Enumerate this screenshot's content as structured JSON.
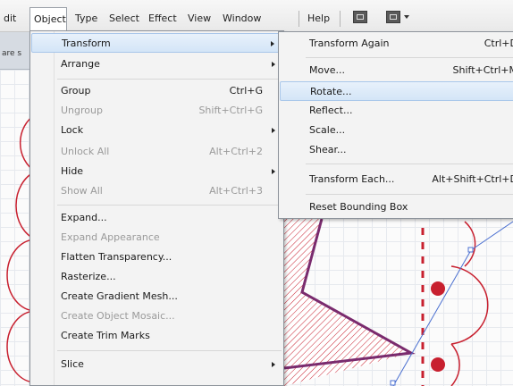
{
  "menubar": {
    "items": [
      {
        "label": "dit"
      },
      {
        "label": "Object"
      },
      {
        "label": "Type"
      },
      {
        "label": "Select"
      },
      {
        "label": "Effect"
      },
      {
        "label": "View"
      },
      {
        "label": "Window"
      },
      {
        "label": "Help"
      }
    ]
  },
  "document_tab": {
    "label": "are s"
  },
  "object_menu": {
    "items": [
      {
        "label": "Transform",
        "shortcut": ""
      },
      {
        "label": "Arrange",
        "shortcut": ""
      },
      {
        "label": "Group",
        "shortcut": "Ctrl+G"
      },
      {
        "label": "Ungroup",
        "shortcut": "Shift+Ctrl+G"
      },
      {
        "label": "Lock",
        "shortcut": ""
      },
      {
        "label": "Unlock All",
        "shortcut": "Alt+Ctrl+2"
      },
      {
        "label": "Hide",
        "shortcut": ""
      },
      {
        "label": "Show All",
        "shortcut": "Alt+Ctrl+3"
      },
      {
        "label": "Expand...",
        "shortcut": ""
      },
      {
        "label": "Expand Appearance",
        "shortcut": ""
      },
      {
        "label": "Flatten Transparency...",
        "shortcut": ""
      },
      {
        "label": "Rasterize...",
        "shortcut": ""
      },
      {
        "label": "Create Gradient Mesh...",
        "shortcut": ""
      },
      {
        "label": "Create Object Mosaic...",
        "shortcut": ""
      },
      {
        "label": "Create Trim Marks",
        "shortcut": ""
      },
      {
        "label": "Slice",
        "shortcut": ""
      }
    ]
  },
  "transform_menu": {
    "items": [
      {
        "label": "Transform Again",
        "shortcut": "Ctrl+D"
      },
      {
        "label": "Move...",
        "shortcut": "Shift+Ctrl+M"
      },
      {
        "label": "Rotate...",
        "shortcut": ""
      },
      {
        "label": "Reflect...",
        "shortcut": ""
      },
      {
        "label": "Scale...",
        "shortcut": ""
      },
      {
        "label": "Shear...",
        "shortcut": ""
      },
      {
        "label": "Transform Each...",
        "shortcut": "Alt+Shift+Ctrl+D"
      },
      {
        "label": "Reset Bounding Box",
        "shortcut": ""
      }
    ]
  },
  "colors": {
    "accent_red": "#c8202f",
    "selection_blue": "#4a6fd0",
    "path_purple": "#7a2b6e",
    "menu_highlight": "#d4e5f7"
  },
  "icons": [
    "arrange-documents-icon",
    "workspace-switcher-icon",
    "chevron-down-icon"
  ]
}
